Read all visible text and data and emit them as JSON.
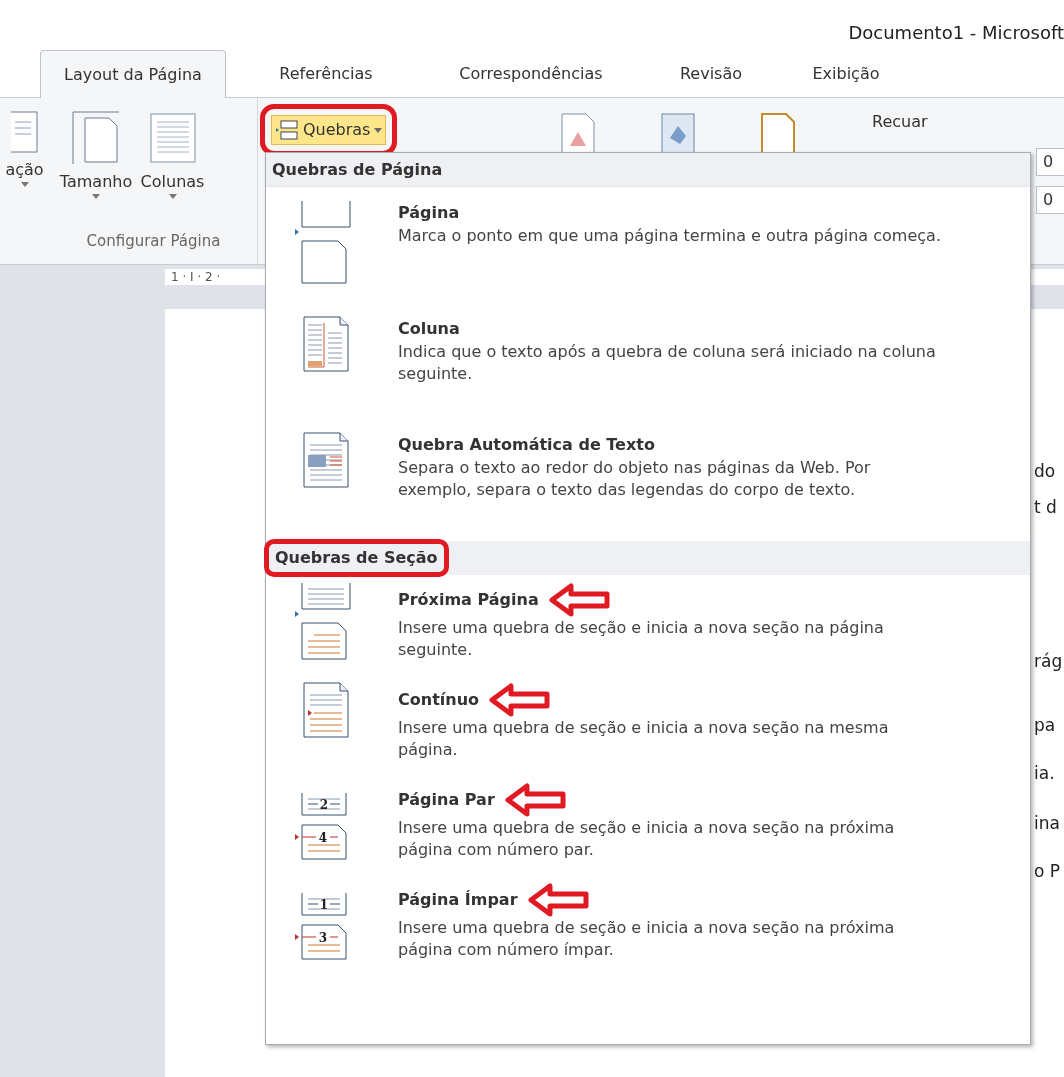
{
  "window": {
    "title": "Documento1 - Microsoft"
  },
  "tabs": [
    {
      "label": "Layout da Página",
      "selected": true
    },
    {
      "label": "Referências",
      "selected": false
    },
    {
      "label": "Correspondências",
      "selected": false
    },
    {
      "label": "Revisão",
      "selected": false
    },
    {
      "label": "Exibição",
      "selected": false
    }
  ],
  "ribbon": {
    "commands": [
      "ação",
      "Tamanho",
      "Colunas"
    ],
    "breaks_button": {
      "label": "Quebras",
      "expanded": true,
      "circled": true
    },
    "indent_label": "Recuar",
    "fields": [
      "0",
      "0"
    ],
    "group_label": "Configurar Página"
  },
  "ruler": {
    "label": "1 · I · 2 ·"
  },
  "document": {
    "fragments": [
      "do",
      "t d",
      "rág",
      "pa",
      "ia.",
      "ina",
      "o P"
    ]
  },
  "menu": {
    "sections": [
      {
        "title": "Quebras de Página",
        "circled": false,
        "items": [
          {
            "kind": "page",
            "title": "Página",
            "description": "Marca o ponto em que uma página termina e outra página começa.",
            "marked": false
          },
          {
            "kind": "column",
            "title": "Coluna",
            "description": "Indica que o texto após a quebra de coluna será iniciado na coluna seguinte.",
            "marked": false
          },
          {
            "kind": "wrap",
            "title": "Quebra Automática de Texto",
            "description": "Separa o texto ao redor do objeto nas páginas da Web. Por exemplo, separa o texto das legendas do corpo de texto.",
            "marked": false
          }
        ]
      },
      {
        "title": "Quebras de Seção",
        "circled": true,
        "items": [
          {
            "kind": "next",
            "title": "Próxima Página",
            "description": "Insere uma quebra de seção e inicia a nova seção na página seguinte.",
            "marked": true
          },
          {
            "kind": "continuous",
            "title": "Contínuo",
            "description": "Insere uma quebra de seção e inicia a nova seção na mesma página.",
            "marked": true
          },
          {
            "kind": "numbered",
            "title": "Página Par",
            "description": "Insere uma quebra de seção e inicia a nova seção na próxima página com número par.",
            "marked": true,
            "icon_numbers": [
              "2",
              "4"
            ]
          },
          {
            "kind": "numbered",
            "title": "Página Ímpar",
            "description": "Insere uma quebra de seção e inicia a nova seção na próxima página com número ímpar.",
            "marked": true,
            "icon_numbers": [
              "1",
              "3"
            ]
          }
        ]
      }
    ]
  }
}
